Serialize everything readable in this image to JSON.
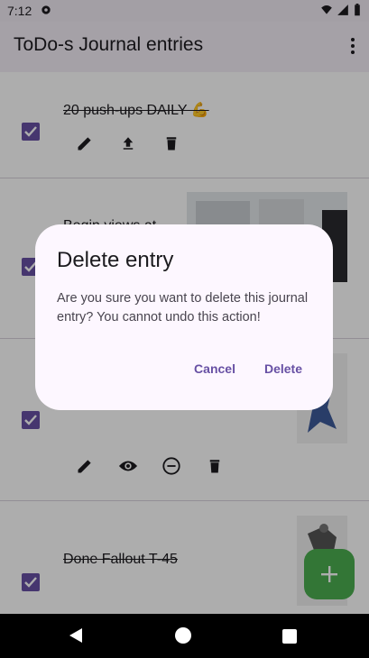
{
  "status_bar": {
    "time": "7:12"
  },
  "app_bar": {
    "title": "ToDo-s Journal entries"
  },
  "entries": [
    {
      "title": "20 push-ups DAILY 💪",
      "checked": true,
      "actions": [
        "edit-icon",
        "upload-icon",
        "delete-icon"
      ]
    },
    {
      "title": "Begin views at",
      "checked": true
    },
    {
      "title": "",
      "checked": true
    },
    {
      "title": "",
      "checked": true,
      "actions": [
        "edit-icon",
        "eye-icon",
        "minus-circle-icon",
        "delete-icon"
      ]
    },
    {
      "title": "Done Fallout T-45",
      "checked": true
    }
  ],
  "dialog": {
    "title": "Delete entry",
    "message": "Are you sure you want to delete this journal entry? You cannot undo this action!",
    "cancel_label": "Cancel",
    "confirm_label": "Delete"
  },
  "colors": {
    "accent": "#6750a4",
    "fab": "#4caf50",
    "dialog_bg": "#fdf7ff"
  }
}
